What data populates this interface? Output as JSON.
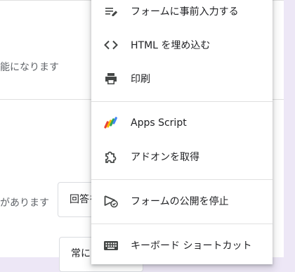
{
  "background": {
    "line1": "能になります",
    "line2": "があります",
    "dropdown1": "回答を",
    "dropdown2": "常に"
  },
  "menu": {
    "items": [
      {
        "label": "フォームに事前入力する",
        "icon": "prefill-icon"
      },
      {
        "label": "HTML を埋め込む",
        "icon": "code-icon"
      },
      {
        "label": "印刷",
        "icon": "print-icon"
      },
      {
        "label": "Apps Script",
        "icon": "apps-script-icon"
      },
      {
        "label": "アドオンを取得",
        "icon": "puzzle-icon"
      },
      {
        "label": "フォームの公開を停止",
        "icon": "unpublish-icon"
      },
      {
        "label": "キーボード ショートカット",
        "icon": "keyboard-icon"
      }
    ]
  },
  "colors": {
    "icon": "#444746",
    "page_bg": "#ede7f6"
  }
}
